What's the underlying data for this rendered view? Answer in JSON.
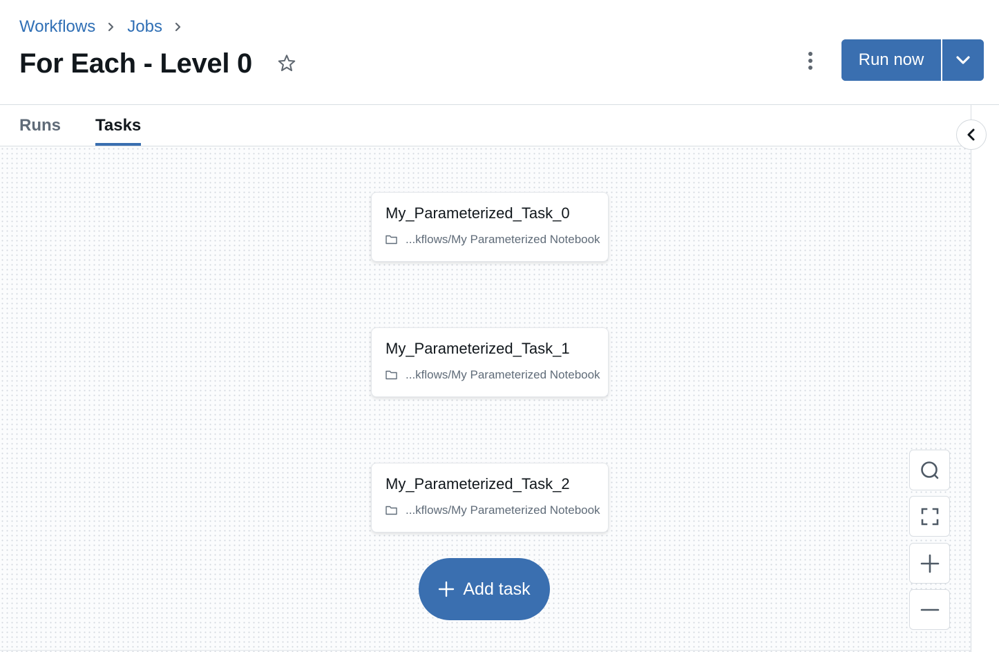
{
  "breadcrumb": {
    "items": [
      {
        "label": "Workflows"
      },
      {
        "label": "Jobs"
      }
    ],
    "separator_icon": "chevron-right-icon"
  },
  "header": {
    "title": "For Each - Level 0",
    "favorite_icon": "star-outline-icon",
    "more_icon": "kebab-vertical-icon",
    "run_now_label": "Run now",
    "run_dropdown_icon": "chevron-down-icon"
  },
  "tabs": [
    {
      "label": "Runs",
      "active": false
    },
    {
      "label": "Tasks",
      "active": true
    }
  ],
  "side_panel": {
    "collapse_icon": "chevron-left-icon"
  },
  "tasks": [
    {
      "name": "My_Parameterized_Task_0",
      "path": "...kflows/My Parameterized Notebook",
      "icon": "folder-icon"
    },
    {
      "name": "My_Parameterized_Task_1",
      "path": "...kflows/My Parameterized Notebook",
      "icon": "folder-icon"
    },
    {
      "name": "My_Parameterized_Task_2",
      "path": "...kflows/My Parameterized Notebook",
      "icon": "folder-icon"
    }
  ],
  "add_task": {
    "label": "Add task",
    "icon": "plus-icon"
  },
  "canvas_controls": [
    {
      "name": "search",
      "icon": "search-icon"
    },
    {
      "name": "fit-view",
      "icon": "fit-view-icon"
    },
    {
      "name": "zoom-in",
      "icon": "plus-icon"
    },
    {
      "name": "zoom-out",
      "icon": "minus-icon"
    }
  ],
  "colors": {
    "primary": "#3a6fb0",
    "link": "#2f6fb5",
    "text": "#11171c",
    "muted": "#5f6b78",
    "border": "#d8dde2"
  }
}
